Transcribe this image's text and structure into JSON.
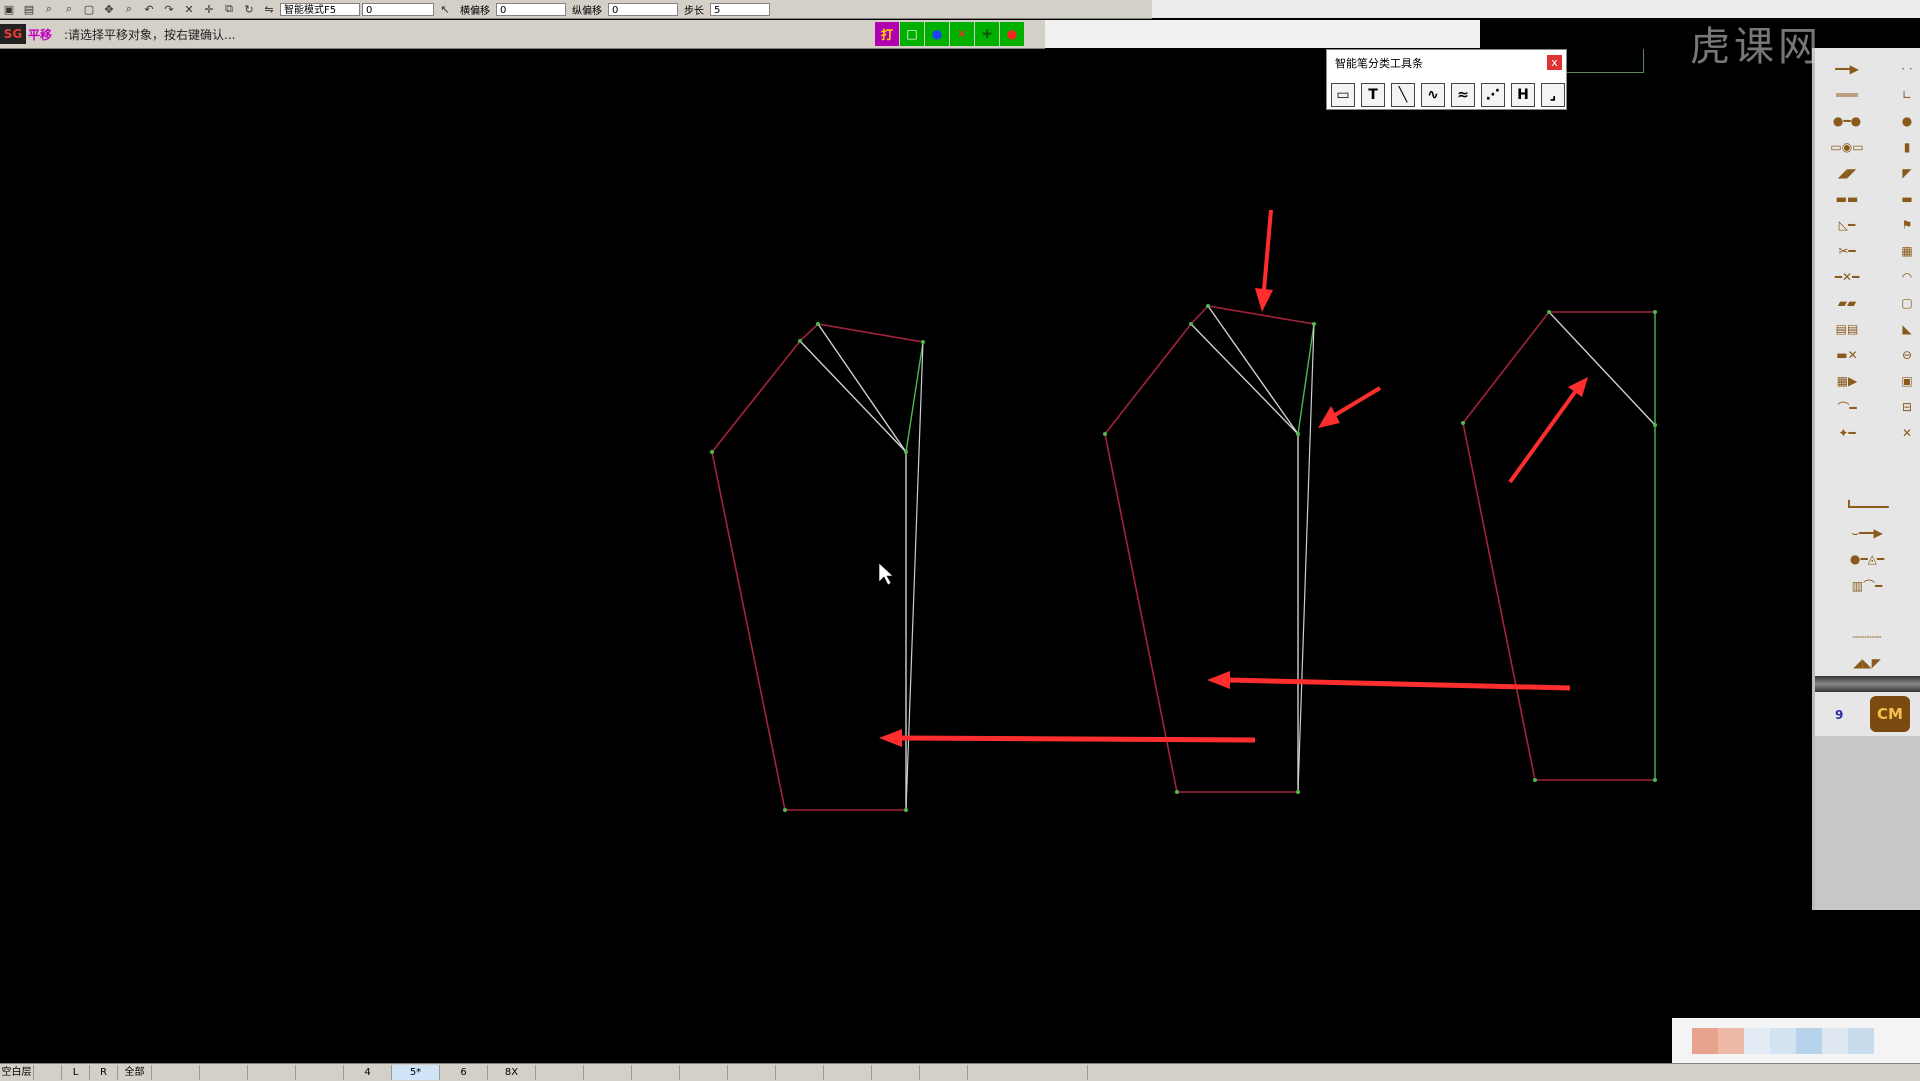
{
  "toolbar": {
    "mode_select": "智能模式F5",
    "mode_value": "0",
    "label_horizontal_offset": "横偏移",
    "value_horizontal_offset": "0",
    "label_vertical_offset": "纵偏移",
    "value_vertical_offset": "0",
    "label_step": "步长",
    "value_step": "5"
  },
  "prompt": {
    "badge": "SG",
    "command": "平移",
    "text": ":请选择平移对象，按右键确认..."
  },
  "snap_tools": [
    {
      "name": "snap-text-icon",
      "glyph": "打",
      "bg": "#b000b0",
      "fg": "#ffe000"
    },
    {
      "name": "snap-square-icon",
      "glyph": "□",
      "bg": "#00b000",
      "fg": "#ffffff"
    },
    {
      "name": "snap-dot-icon",
      "glyph": "●",
      "bg": "#00b000",
      "fg": "#2040ff"
    },
    {
      "name": "snap-cross-icon",
      "glyph": "✕",
      "bg": "#00b000",
      "fg": "#ff2020"
    },
    {
      "name": "snap-point-icon",
      "glyph": "✚",
      "bg": "#00b000",
      "fg": "#0b5f0b"
    },
    {
      "name": "snap-red-dot-icon",
      "glyph": "●",
      "bg": "#00b000",
      "fg": "#ff2020"
    }
  ],
  "pen_panel": {
    "title": "智能笔分类工具条",
    "close": "x",
    "tools": [
      {
        "name": "rectangle-tool-icon",
        "glyph": "▭"
      },
      {
        "name": "text-tool-icon",
        "glyph": "T"
      },
      {
        "name": "line-tool-icon",
        "glyph": "╲"
      },
      {
        "name": "curve-tool-icon",
        "glyph": "∿"
      },
      {
        "name": "wave-tool-icon",
        "glyph": "≈"
      },
      {
        "name": "point-tool-icon",
        "glyph": "⋰"
      },
      {
        "name": "h-tool-icon",
        "glyph": "H"
      },
      {
        "name": "corner-tool-icon",
        "glyph": "⌟"
      }
    ]
  },
  "palette": {
    "number": "9",
    "cm_button": "CM"
  },
  "watermark": "虎课网",
  "status": {
    "cells": [
      "空白层",
      "",
      "L",
      "R",
      "全部",
      "",
      "",
      "",
      "",
      "4",
      "5*",
      "6",
      "8X",
      "",
      "",
      "",
      "",
      "",
      "",
      "",
      "",
      "",
      ""
    ]
  },
  "colors": {
    "outline_red": "#a3233a",
    "center_green": "#4fb84f",
    "dart_white": "#cfcfcf",
    "arrow_red": "#ff2e2e"
  }
}
